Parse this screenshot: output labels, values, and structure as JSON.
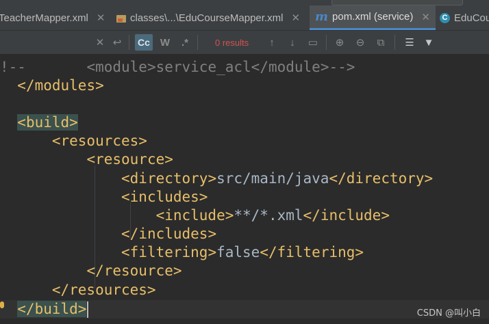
{
  "tabs": [
    {
      "label": "TeacherMapper.xml",
      "icon": "xml-file-icon",
      "active": false
    },
    {
      "label": "classes\\...\\EduCourseMapper.xml",
      "icon": "folder-xml-icon",
      "active": false
    },
    {
      "label": "pom.xml (service)",
      "icon": "maven-icon",
      "active": true
    },
    {
      "label": "EduCou",
      "icon": "class-icon",
      "active": false
    }
  ],
  "find": {
    "case_label": "Cc",
    "words_label": "W",
    "regex_label": ".*",
    "results": "0 results"
  },
  "code": [
    {
      "indent": "!--       ",
      "segments": [
        {
          "t": "<module>",
          "c": "cmt"
        },
        {
          "t": "service_acl",
          "c": "cmt"
        },
        {
          "t": "</module>-->",
          "c": "cmt"
        }
      ]
    },
    {
      "indent": "  ",
      "segments": [
        {
          "t": "</modules>",
          "c": "tag"
        }
      ]
    },
    {
      "indent": "",
      "segments": []
    },
    {
      "indent": "  ",
      "segments": [
        {
          "t": "<build>",
          "c": "tag hl"
        }
      ]
    },
    {
      "indent": "      ",
      "segments": [
        {
          "t": "<resources>",
          "c": "tag"
        }
      ]
    },
    {
      "indent": "          ",
      "segments": [
        {
          "t": "<resource>",
          "c": "tag"
        }
      ]
    },
    {
      "indent": "              ",
      "segments": [
        {
          "t": "<directory>",
          "c": "tag"
        },
        {
          "t": "src/main/java",
          "c": "txt"
        },
        {
          "t": "</directory>",
          "c": "tag"
        }
      ]
    },
    {
      "indent": "              ",
      "segments": [
        {
          "t": "<includes>",
          "c": "tag"
        }
      ]
    },
    {
      "indent": "                  ",
      "segments": [
        {
          "t": "<include>",
          "c": "tag"
        },
        {
          "t": "**/*.xml",
          "c": "txt"
        },
        {
          "t": "</include>",
          "c": "tag"
        }
      ]
    },
    {
      "indent": "              ",
      "segments": [
        {
          "t": "</includes>",
          "c": "tag"
        }
      ]
    },
    {
      "indent": "              ",
      "segments": [
        {
          "t": "<filtering>",
          "c": "tag"
        },
        {
          "t": "false",
          "c": "txt"
        },
        {
          "t": "</filtering>",
          "c": "tag"
        }
      ]
    },
    {
      "indent": "          ",
      "segments": [
        {
          "t": "</resource>",
          "c": "tag"
        }
      ]
    },
    {
      "indent": "      ",
      "segments": [
        {
          "t": "</resources>",
          "c": "tag"
        }
      ]
    },
    {
      "indent": "  ",
      "segments": [
        {
          "t": "</build>",
          "c": "tag hl"
        }
      ]
    }
  ],
  "watermark": "CSDN @叫小白",
  "colors": {
    "tag": "#e8bf6a",
    "text": "#a9b7c6",
    "comment": "#808080",
    "accent": "#4a88c7",
    "error": "#d25252"
  }
}
